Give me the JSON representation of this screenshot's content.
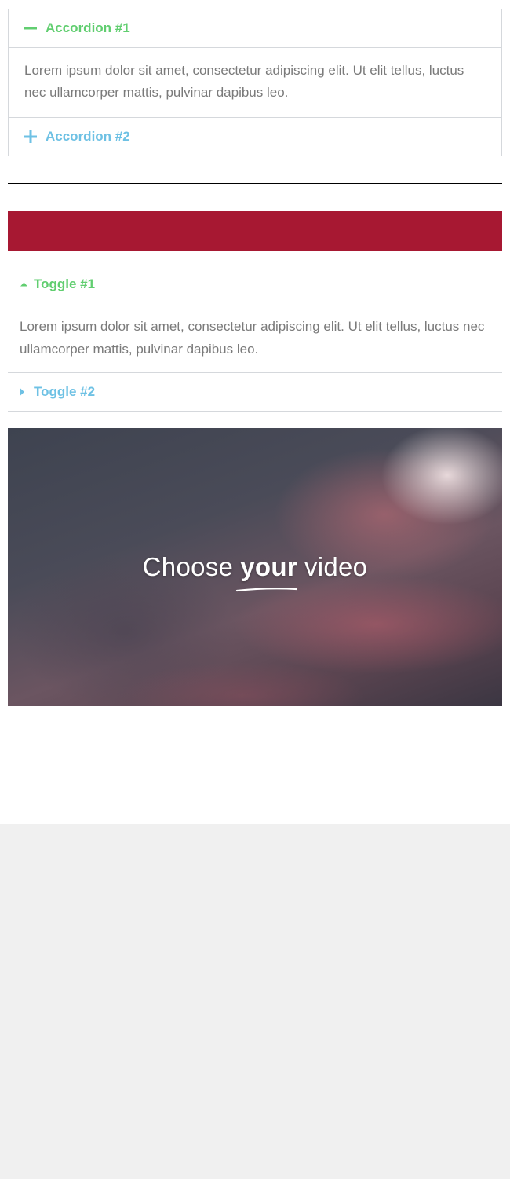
{
  "accordion": {
    "items": [
      {
        "title": "Accordion #1",
        "icon": "minus-icon",
        "expanded": true,
        "content": "Lorem ipsum dolor sit amet, consectetur adipiscing elit. Ut elit tellus, luctus nec ullamcorper mattis, pulvinar dapibus leo."
      },
      {
        "title": "Accordion #2",
        "icon": "plus-icon",
        "expanded": false
      }
    ]
  },
  "toggle": {
    "items": [
      {
        "title": "Toggle #1",
        "icon": "caret-up-icon",
        "expanded": true,
        "content": "Lorem ipsum dolor sit amet, consectetur adipiscing elit. Ut elit tellus, luctus nec ullamcorper mattis, pulvinar dapibus leo."
      },
      {
        "title": "Toggle #2",
        "icon": "caret-right-icon",
        "expanded": false
      }
    ]
  },
  "video": {
    "caption_pre": "Choose",
    "caption_emph": "your",
    "caption_post": "video"
  },
  "colors": {
    "active": "#61ce70",
    "inactive": "#6ec1e4",
    "text": "#7a7a7a",
    "banner": "#a71832",
    "border": "#d5d8dc",
    "page_background": "#ffffff",
    "outer_background": "#f0f0f0"
  }
}
